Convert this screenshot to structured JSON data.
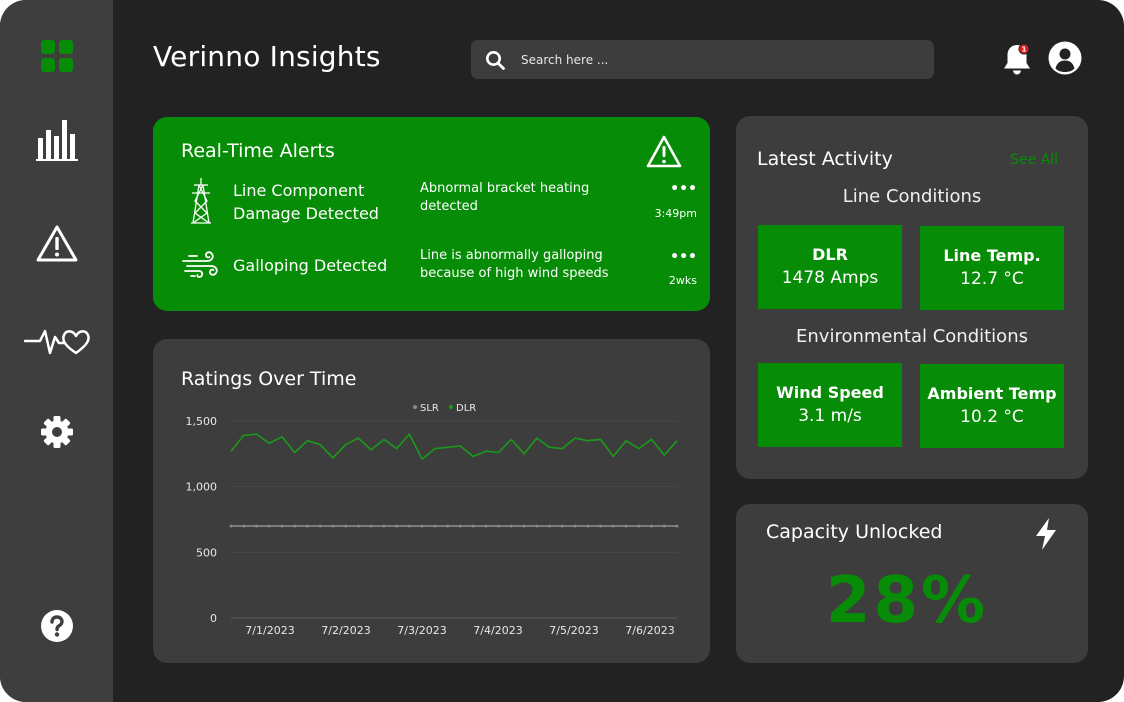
{
  "app": {
    "title": "Verinno Insights"
  },
  "search": {
    "placeholder": "Search here ..."
  },
  "header": {
    "notification_count": "1"
  },
  "sidebar": {
    "items": [
      {
        "icon": "dashboard-icon",
        "active": true
      },
      {
        "icon": "bar-chart-icon",
        "active": false
      },
      {
        "icon": "warning-icon",
        "active": false
      },
      {
        "icon": "heart-pulse-icon",
        "active": false
      },
      {
        "icon": "gear-icon",
        "active": false
      },
      {
        "icon": "help-icon",
        "active": false
      }
    ]
  },
  "alerts": {
    "title": "Real-Time Alerts",
    "items": [
      {
        "icon": "transmission-tower-icon",
        "name": "Line Component Damage Detected",
        "description": "Abnormal bracket heating detected",
        "time": "3:49pm",
        "more": "•••"
      },
      {
        "icon": "wind-icon",
        "name": "Galloping Detected",
        "description": "Line is abnormally galloping because of high wind speeds",
        "time": "2wks",
        "more": "•••"
      }
    ]
  },
  "ratings": {
    "title": "Ratings Over Time"
  },
  "chart_data": {
    "type": "line",
    "ylim": [
      0,
      1500
    ],
    "yticks": [
      "0",
      "500",
      "1,000",
      "1,500"
    ],
    "xticks": [
      "7/1/2023",
      "7/2/2023",
      "7/3/2023",
      "7/4/2023",
      "7/5/2023",
      "7/6/2023"
    ],
    "legend": {
      "position": "top-center"
    },
    "series": [
      {
        "name": "SLR",
        "color": "#8a8a8a",
        "values": [
          700,
          700,
          700,
          700,
          700,
          700,
          700,
          700,
          700,
          700,
          700,
          700,
          700,
          700,
          700,
          700,
          700,
          700,
          700,
          700,
          700,
          700,
          700,
          700,
          700,
          700,
          700,
          700,
          700,
          700,
          700,
          700,
          700,
          700,
          700,
          700
        ]
      },
      {
        "name": "DLR",
        "color": "#1a9a1a",
        "values": [
          1270,
          1390,
          1400,
          1330,
          1380,
          1260,
          1350,
          1320,
          1220,
          1320,
          1370,
          1280,
          1360,
          1290,
          1400,
          1210,
          1290,
          1300,
          1310,
          1230,
          1270,
          1260,
          1360,
          1250,
          1370,
          1300,
          1290,
          1370,
          1350,
          1360,
          1230,
          1350,
          1290,
          1360,
          1240,
          1350
        ]
      }
    ],
    "grid": true
  },
  "activity": {
    "title": "Latest Activity",
    "see_all": "See All",
    "line_section": "Line Conditions",
    "env_section": "Environmental Conditions",
    "tiles": [
      {
        "label": "DLR",
        "value": "1478 Amps"
      },
      {
        "label": "Line Temp.",
        "value": "12.7 °C"
      },
      {
        "label": "Wind Speed",
        "value": "3.1 m/s"
      },
      {
        "label": "Ambient Temp",
        "value": "10.2 °C"
      }
    ]
  },
  "capacity": {
    "title": "Capacity Unlocked",
    "value": "28%"
  },
  "colors": {
    "accent": "#078c07",
    "background": "#222222",
    "panel": "#3d3d3d",
    "sidebar": "#3e3e3e"
  }
}
